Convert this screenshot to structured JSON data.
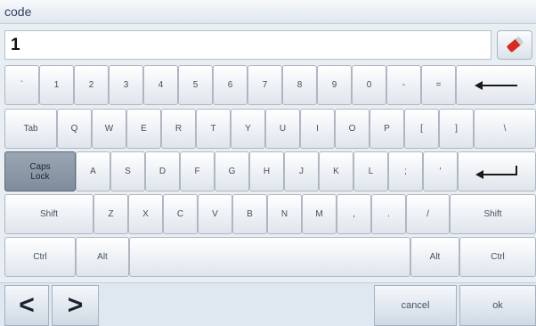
{
  "window": {
    "title": "code"
  },
  "input": {
    "value": "1"
  },
  "icons": {
    "clear": "eraser-icon",
    "backspace": "backspace-arrow-icon",
    "enter": "enter-arrow-icon"
  },
  "keys": {
    "backtick": "`",
    "k1": "1",
    "k2": "2",
    "k3": "3",
    "k4": "4",
    "k5": "5",
    "k6": "6",
    "k7": "7",
    "k8": "8",
    "k9": "9",
    "k0": "0",
    "minus": "-",
    "equals": "=",
    "tab": "Tab",
    "q": "Q",
    "w": "W",
    "e": "E",
    "r": "R",
    "t": "T",
    "y": "Y",
    "u": "U",
    "i": "I",
    "o": "O",
    "p": "P",
    "lbracket": "[",
    "rbracket": "]",
    "backslash": "\\",
    "caps": "Caps\nLock",
    "a": "A",
    "s": "S",
    "d": "D",
    "f": "F",
    "g": "G",
    "h": "H",
    "j": "J",
    "k": "K",
    "l": "L",
    "semicolon": ";",
    "quote": "'",
    "shift_left": "Shift",
    "z": "Z",
    "x": "X",
    "c": "C",
    "v": "V",
    "b": "B",
    "n": "N",
    "m": "M",
    "comma": ",",
    "period": ".",
    "slash": "/",
    "shift_right": "Shift",
    "ctrl_left": "Ctrl",
    "alt_left": "Alt",
    "alt_right": "Alt",
    "ctrl_right": "Ctrl"
  },
  "footer": {
    "prev": "<",
    "next": ">",
    "cancel": "cancel",
    "ok": "ok"
  }
}
